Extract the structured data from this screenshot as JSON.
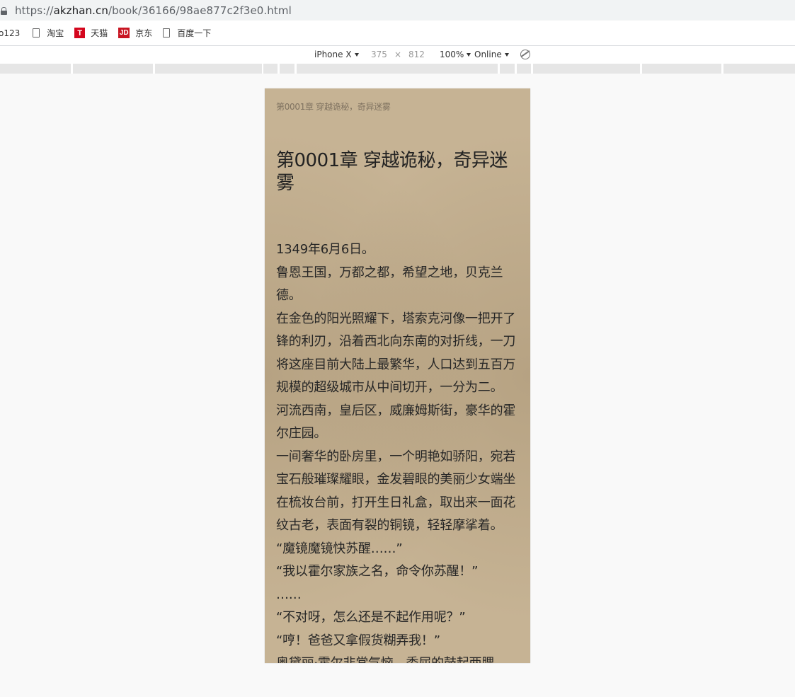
{
  "browser": {
    "url_scheme": "https://",
    "url_host": "akzhan.cn",
    "url_path": "/book/36166/98ae877c2f3e0.html"
  },
  "bookmarks": [
    {
      "label": "o123",
      "icon": "none"
    },
    {
      "label": "淘宝",
      "icon": "page-icon"
    },
    {
      "label": "天猫",
      "icon": "tmall-icon",
      "icon_text": "T",
      "color": "#d4061d"
    },
    {
      "label": "京东",
      "icon": "jd-icon",
      "icon_text": "JD",
      "color": "#c81623"
    },
    {
      "label": "百度一下",
      "icon": "page-icon"
    }
  ],
  "device_toolbar": {
    "device": "iPhone X",
    "width": "375",
    "times": "×",
    "height": "812",
    "zoom": "100%",
    "network": "Online"
  },
  "page": {
    "breadcrumb": "第0001章 穿越诡秘，奇异迷雾",
    "chapter_title": "第0001章 穿越诡秘，奇异迷雾",
    "paragraphs": [
      "1349年6月6日。",
      "鲁恩王国，万都之都，希望之地，贝克兰德。",
      "在金色的阳光照耀下，塔索克河像一把开了锋的利刃，沿着西北向东南的对折线，一刀将这座目前大陆上最繁华，人口达到五百万规模的超级城市从中间切开，一分为二。",
      "河流西南，皇后区，威廉姆斯街，豪华的霍尔庄园。",
      "一间奢华的卧房里，一个明艳如骄阳，宛若宝石般璀璨耀眼，金发碧眼的美丽少女端坐在梳妆台前，打开生日礼盒，取出来一面花纹古老，表面有裂的铜镜，轻轻摩挲着。",
      "“魔镜魔镜快苏醒……”",
      "“我以霍尔家族之名，命令你苏醒！”",
      "……",
      "“不对呀，怎么还是不起作用呢？”",
      "“哼！爸爸又拿假货糊弄我！”",
      "奥黛丽·霍尔非常气恼，委屈的鼓起两腮。"
    ]
  },
  "colors": {
    "page_background": "#c6b394",
    "text": "#262626"
  }
}
